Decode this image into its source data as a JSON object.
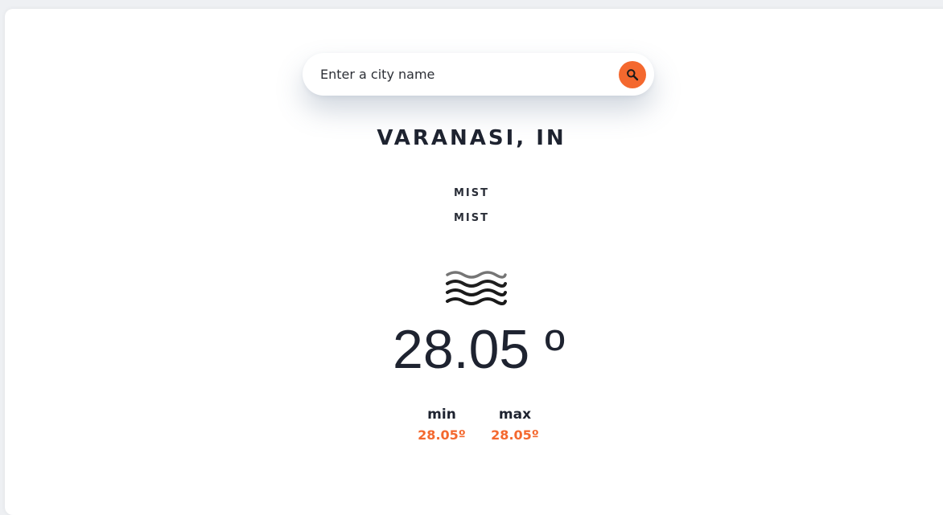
{
  "search": {
    "placeholder": "Enter a city name",
    "button_icon": "search-icon",
    "accent_color": "#f4682e"
  },
  "location": {
    "name": "VARANASI, IN"
  },
  "conditions": {
    "main": "MIST",
    "description": "MIST",
    "icon": "mist-icon"
  },
  "temperature": {
    "current": "28.05 º",
    "min_label": "min",
    "min_value": "28.05º",
    "max_label": "max",
    "max_value": "28.05º"
  }
}
